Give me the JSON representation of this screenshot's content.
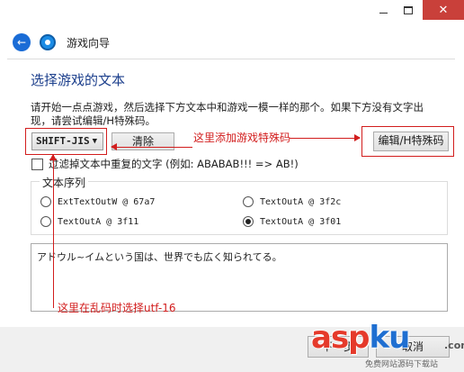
{
  "window": {
    "close_glyph": "✕",
    "accent": "#c9403a"
  },
  "nav": {
    "back_glyph": "←",
    "title": "游戏向导"
  },
  "page": {
    "title": "选择游戏的文本",
    "desc_line1": "请开始一点点游戏，然后选择下方文本中和游戏一模一样的那个。如果下方没有文字出",
    "desc_line2": "现，请尝试编辑/H特殊码。"
  },
  "encoding": {
    "selected": "SHIFT-JIS",
    "arrow_glyph": "▼"
  },
  "buttons": {
    "clear": "清除",
    "edit_hcode": "编辑/H特殊码",
    "next": "下一步",
    "cancel": "取消"
  },
  "annotations": {
    "add_hcode": "这里添加游戏特殊码",
    "encoding_tip": "这里在乱码时选择utf-16",
    "color": "#d21d1d"
  },
  "filter": {
    "label": "过滤掉文本中重复的文字 (例如: ABABAB!!! => AB!)",
    "checked": false
  },
  "sequence": {
    "legend": "文本序列",
    "options": [
      {
        "label": "ExtTextOutW @ 67a7",
        "selected": false
      },
      {
        "label": "TextOutA @ 3f2c",
        "selected": false
      },
      {
        "label": "TextOutA @ 3f11",
        "selected": false
      },
      {
        "label": "TextOutA @ 3f01",
        "selected": true
      }
    ]
  },
  "preview": {
    "text": "アドウル~イムという国は、世界でも広く知られてる。"
  },
  "watermark": {
    "part1": "asp",
    "part2": "ku",
    "tld": ".com",
    "subtitle": "免费网站源码下载站"
  }
}
